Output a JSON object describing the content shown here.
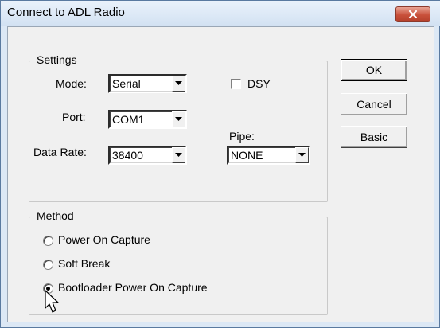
{
  "window": {
    "title": "Connect to ADL Radio"
  },
  "settings": {
    "group_label": "Settings",
    "mode": {
      "label": "Mode:",
      "value": "Serial"
    },
    "port": {
      "label": "Port:",
      "value": "COM1"
    },
    "data_rate": {
      "label": "Data Rate:",
      "value": "38400"
    },
    "dsy": {
      "label": "DSY",
      "checked": false
    },
    "pipe": {
      "label": "Pipe:",
      "value": "NONE"
    }
  },
  "buttons": {
    "ok": "OK",
    "cancel": "Cancel",
    "basic": "Basic"
  },
  "method": {
    "group_label": "Method",
    "options": [
      {
        "label": "Power On Capture",
        "selected": false
      },
      {
        "label": "Soft Break",
        "selected": false
      },
      {
        "label": "Bootloader Power On Capture",
        "selected": true
      }
    ]
  },
  "icons": {
    "close": "close-icon",
    "dropdown": "chevron-down-icon",
    "cursor": "mouse-pointer-icon"
  },
  "colors": {
    "title_bar": "#d2e1f2",
    "close_button": "#c8503a",
    "dialog_bg": "#f0f0f0"
  }
}
